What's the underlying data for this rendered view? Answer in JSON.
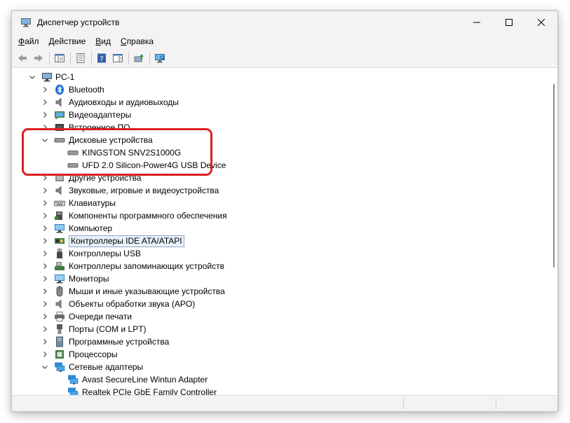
{
  "window": {
    "title": "Диспетчер устройств",
    "icon": "device-manager-icon"
  },
  "menu": [
    {
      "key": "Ф",
      "rest": "айл"
    },
    {
      "key": "Д",
      "rest": "ействие"
    },
    {
      "key": "В",
      "rest": "ид"
    },
    {
      "key": "С",
      "rest": "правка"
    }
  ],
  "tree": {
    "root": "PC-1",
    "items": [
      {
        "label": "Bluetooth",
        "icon": "bluetooth-icon",
        "expanded": false
      },
      {
        "label": "Аудиовходы и аудиовыходы",
        "icon": "speaker-icon",
        "expanded": false
      },
      {
        "label": "Видеоадаптеры",
        "icon": "display-adapter-icon",
        "expanded": false
      },
      {
        "label": "Встроенное ПО",
        "icon": "firmware-icon",
        "expanded": false
      },
      {
        "label": "Дисковые устройства",
        "icon": "disk-drive-icon",
        "expanded": true,
        "children": [
          {
            "label": "KINGSTON SNV2S1000G",
            "icon": "disk-drive-icon"
          },
          {
            "label": "UFD 2.0 Silicon-Power4G USB Device",
            "icon": "disk-drive-icon"
          }
        ]
      },
      {
        "label": "Другие устройства",
        "icon": "unknown-device-icon",
        "expanded": false
      },
      {
        "label": "Звуковые, игровые и видеоустройства",
        "icon": "speaker-icon",
        "expanded": false
      },
      {
        "label": "Клавиатуры",
        "icon": "keyboard-icon",
        "expanded": false
      },
      {
        "label": "Компоненты программного обеспечения",
        "icon": "software-component-icon",
        "expanded": false
      },
      {
        "label": "Компьютер",
        "icon": "computer-icon",
        "expanded": false
      },
      {
        "label": "Контроллеры IDE ATA/ATAPI",
        "icon": "ide-controller-icon",
        "expanded": false,
        "selected": true
      },
      {
        "label": "Контроллеры USB",
        "icon": "usb-icon",
        "expanded": false
      },
      {
        "label": "Контроллеры запоминающих устройств",
        "icon": "storage-controller-icon",
        "expanded": false
      },
      {
        "label": "Мониторы",
        "icon": "monitor-icon",
        "expanded": false
      },
      {
        "label": "Мыши и иные указывающие устройства",
        "icon": "mouse-icon",
        "expanded": false
      },
      {
        "label": "Объекты обработки звука (APO)",
        "icon": "speaker-icon",
        "expanded": false
      },
      {
        "label": "Очереди печати",
        "icon": "printer-icon",
        "expanded": false
      },
      {
        "label": "Порты (COM и LPT)",
        "icon": "port-icon",
        "expanded": false
      },
      {
        "label": "Программные устройства",
        "icon": "software-device-icon",
        "expanded": false
      },
      {
        "label": "Процессоры",
        "icon": "processor-icon",
        "expanded": false
      },
      {
        "label": "Сетевые адаптеры",
        "icon": "network-adapter-icon",
        "expanded": true,
        "children": [
          {
            "label": "Avast SecureLine Wintun Adapter",
            "icon": "network-adapter-icon"
          },
          {
            "label": "Realtek PCIe GbE Family Controller",
            "icon": "network-adapter-icon"
          }
        ]
      }
    ]
  },
  "colors": {
    "highlight": "#e01e24",
    "chrome": "#f3f3f3",
    "monitor_blue": "#2f8fd8"
  }
}
